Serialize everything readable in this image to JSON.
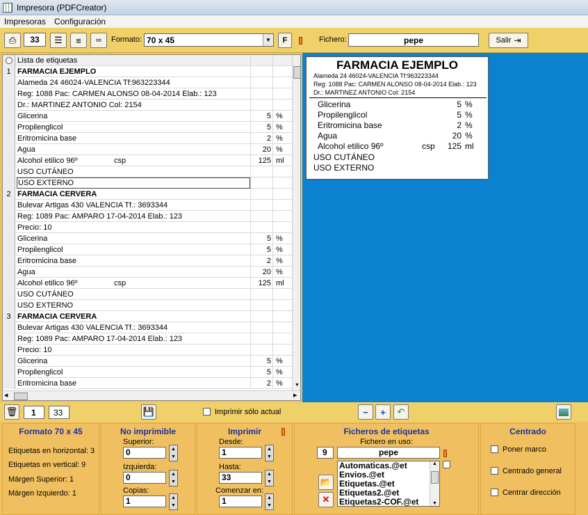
{
  "window": {
    "title": "Impresora (PDFCreator)"
  },
  "menu": [
    "Impresoras",
    "Configuración"
  ],
  "toolbar": {
    "count": "33",
    "format_label": "Formato:",
    "format_value": "70 x 45",
    "f_button": "F",
    "file_label": "Fichero:",
    "file_value": "pepe",
    "exit_label": "Salir"
  },
  "grid": {
    "header": "Lista de etiquetas",
    "rows": [
      {
        "num": "1",
        "text": "FARMACIA EJEMPLO",
        "bold": true,
        "csp": "",
        "val": "",
        "unit": ""
      },
      {
        "num": "",
        "text": "Alameda 24 46024-VALENCIA Tf:963223344",
        "csp": "",
        "val": "",
        "unit": ""
      },
      {
        "num": "",
        "text": "Reg: 1088 Pac: CARMEN ALONSO 08-04-2014 Elab.: 123",
        "csp": "",
        "val": "",
        "unit": ""
      },
      {
        "num": "",
        "text": "Dr.: MARTINEZ ANTONIO Col: 2154",
        "csp": "",
        "val": "",
        "unit": ""
      },
      {
        "num": "",
        "text": "Glicerina",
        "csp": "",
        "val": "5",
        "unit": "%"
      },
      {
        "num": "",
        "text": "Propilenglicol",
        "csp": "",
        "val": "5",
        "unit": "%"
      },
      {
        "num": "",
        "text": "Eritromicina base",
        "csp": "",
        "val": "2",
        "unit": "%"
      },
      {
        "num": "",
        "text": "Agua",
        "csp": "",
        "val": "20",
        "unit": "%"
      },
      {
        "num": "",
        "text": "Alcohol etilico 96º",
        "csp": "csp",
        "val": "125",
        "unit": "ml"
      },
      {
        "num": "",
        "text": "USO CUTÁNEO",
        "csp": "",
        "val": "",
        "unit": ""
      },
      {
        "num": "",
        "text": "USO EXTERNO",
        "csp": "",
        "val": "",
        "unit": "",
        "selected": true
      },
      {
        "num": "2",
        "text": "FARMACIA CERVERA",
        "bold": true,
        "csp": "",
        "val": "",
        "unit": ""
      },
      {
        "num": "",
        "text": "Bulevar Artigas 430  VALENCIA  Tf.: 3693344",
        "csp": "",
        "val": "",
        "unit": ""
      },
      {
        "num": "",
        "text": "Reg: 1089 Pac: AMPARO 17-04-2014 Elab.: 123",
        "csp": "",
        "val": "",
        "unit": ""
      },
      {
        "num": "",
        "text": "Precio: 10",
        "csp": "",
        "val": "",
        "unit": ""
      },
      {
        "num": "",
        "text": "Glicerina",
        "csp": "",
        "val": "5",
        "unit": "%"
      },
      {
        "num": "",
        "text": "Propilenglicol",
        "csp": "",
        "val": "5",
        "unit": "%"
      },
      {
        "num": "",
        "text": "Eritromicina base",
        "csp": "",
        "val": "2",
        "unit": "%"
      },
      {
        "num": "",
        "text": "Agua",
        "csp": "",
        "val": "20",
        "unit": "%"
      },
      {
        "num": "",
        "text": "Alcohol etilico 96º",
        "csp": "csp",
        "val": "125",
        "unit": "ml"
      },
      {
        "num": "",
        "text": "USO CUTÁNEO",
        "csp": "",
        "val": "",
        "unit": ""
      },
      {
        "num": "",
        "text": "USO EXTERNO",
        "csp": "",
        "val": "",
        "unit": ""
      },
      {
        "num": "3",
        "text": "FARMACIA CERVERA",
        "bold": true,
        "csp": "",
        "val": "",
        "unit": ""
      },
      {
        "num": "",
        "text": "Bulevar Artigas 430  VALENCIA  Tf.: 3693344",
        "csp": "",
        "val": "",
        "unit": ""
      },
      {
        "num": "",
        "text": "Reg: 1089 Pac: AMPARO 17-04-2014 Elab.: 123",
        "csp": "",
        "val": "",
        "unit": ""
      },
      {
        "num": "",
        "text": "Precio: 10",
        "csp": "",
        "val": "",
        "unit": ""
      },
      {
        "num": "",
        "text": "Glicerina",
        "csp": "",
        "val": "5",
        "unit": "%"
      },
      {
        "num": "",
        "text": "Propilenglicol",
        "csp": "",
        "val": "5",
        "unit": "%"
      },
      {
        "num": "",
        "text": "Eritromicina base",
        "csp": "",
        "val": "2",
        "unit": "%"
      }
    ]
  },
  "preview": {
    "title": "FARMACIA EJEMPLO",
    "line1": "Alameda 24 46024-VALENCIA Tf:963223344",
    "line2": "Reg: 1088 Pac: CARMEN ALONSO 08-04-2014 Elab.: 123",
    "line3": "Dr.: MARTINEZ ANTONIO Col: 2154",
    "items": [
      {
        "name": "Glicerina",
        "csp": "",
        "val": "5",
        "unit": "%"
      },
      {
        "name": "Propilenglicol",
        "csp": "",
        "val": "5",
        "unit": "%"
      },
      {
        "name": "Eritromicina base",
        "csp": "",
        "val": "2",
        "unit": "%"
      },
      {
        "name": "Agua",
        "csp": "",
        "val": "20",
        "unit": "%"
      },
      {
        "name": "Alcohol etilico 96º",
        "csp": "csp",
        "val": "125",
        "unit": "ml"
      }
    ],
    "foot1": "USO CUTÁNEO",
    "foot2": "USO EXTERNO"
  },
  "bottombar": {
    "page": "1",
    "total": "33",
    "print_current": "Imprimir sólo actual"
  },
  "formato": {
    "title": "Formato 70 x 45",
    "h": "Etiquetas en horizontal: 3",
    "v": "Etiquetas en vertical: 9",
    "ms": "Márgen Superior: 1",
    "mi": "Márgen  Izquierdo: 1"
  },
  "noimp": {
    "title": "No imprimible",
    "sup_label": "Superior:",
    "sup": "0",
    "izq_label": "Izquierda:",
    "izq": "0",
    "cop_label": "Copias:",
    "cop": "1"
  },
  "imprimir": {
    "title": "Imprimir",
    "desde_label": "Desde:",
    "desde": "1",
    "hasta_label": "Hasta:",
    "hasta": "33",
    "comenzar_label": "Comenzar en:",
    "comenzar": "1"
  },
  "ficheros": {
    "title": "Ficheros de etiquetas",
    "uso_label": "Fichero en uso:",
    "num": "9",
    "file": "pepe",
    "list": [
      "Automaticas.@et",
      "Envios.@et",
      "Etiquetas.@et",
      "Etiquetas2.@et",
      "Etiquetas2-COF.@et"
    ]
  },
  "centrado": {
    "title": "Centrado",
    "c1": "Poner marco",
    "c2": "Centrado general",
    "c3": "Centrar dirección"
  }
}
